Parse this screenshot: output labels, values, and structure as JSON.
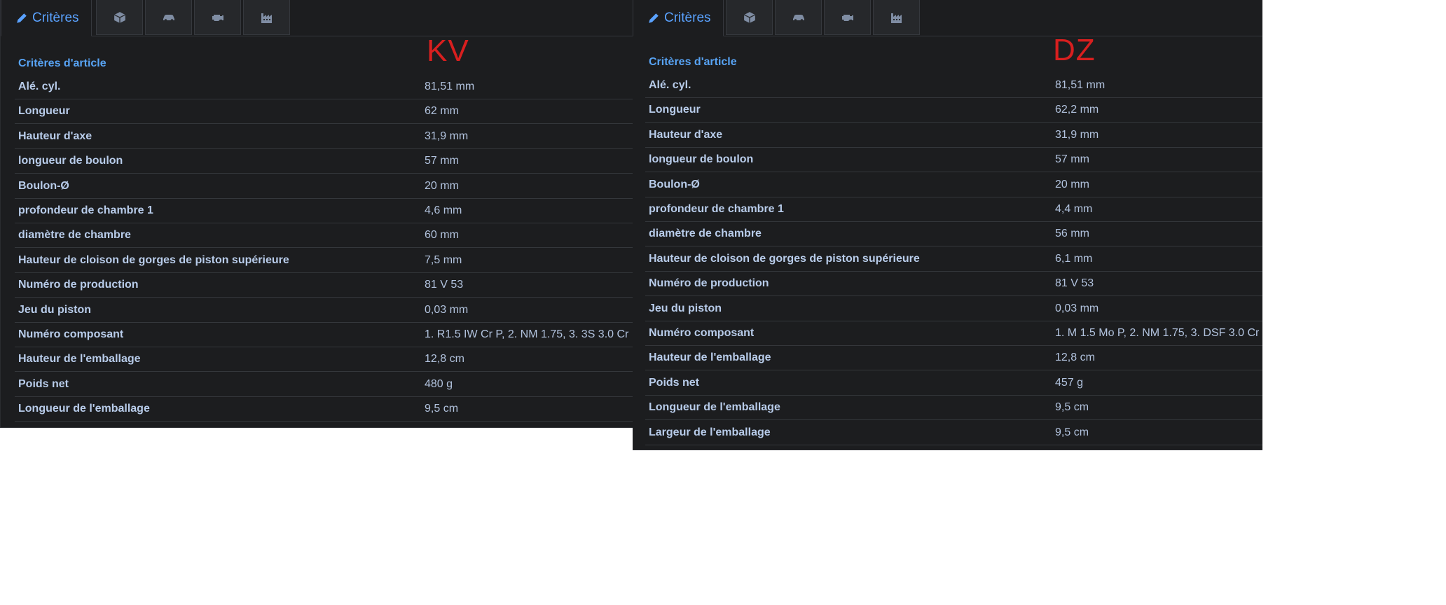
{
  "tabs": {
    "active_label": "Critères",
    "icons": [
      "cube-icon",
      "car-icon",
      "engine-icon",
      "factory-icon"
    ]
  },
  "colors": {
    "background": "#1c1d1f",
    "accent": "#58a4f5",
    "brand": "#d81f1f"
  },
  "panels": [
    {
      "brand": "KV",
      "section_title": "Critères d'article",
      "rows": [
        {
          "label": "Alé. cyl.",
          "value": "81,51 mm"
        },
        {
          "label": "Longueur",
          "value": "62 mm"
        },
        {
          "label": "Hauteur d'axe",
          "value": "31,9 mm"
        },
        {
          "label": "longueur de boulon",
          "value": "57 mm"
        },
        {
          "label": "Boulon-Ø",
          "value": "20 mm"
        },
        {
          "label": "profondeur de chambre 1",
          "value": "4,6 mm"
        },
        {
          "label": "diamètre de chambre",
          "value": "60 mm"
        },
        {
          "label": "Hauteur de cloison de gorges de piston supérieure",
          "value": "7,5 mm"
        },
        {
          "label": "Numéro de production",
          "value": "81 V 53"
        },
        {
          "label": "Jeu du piston",
          "value": "0,03 mm"
        },
        {
          "label": "Numéro composant",
          "value": "1. R1.5 IW Cr P, 2. NM 1.75, 3. 3S 3.0 Cr"
        },
        {
          "label": "Hauteur de l'emballage",
          "value": "12,8 cm"
        },
        {
          "label": "Poids net",
          "value": "480 g"
        },
        {
          "label": "Longueur de l'emballage",
          "value": "9,5 cm"
        }
      ]
    },
    {
      "brand": "DZ",
      "section_title": "Critères d'article",
      "rows": [
        {
          "label": "Alé. cyl.",
          "value": "81,51 mm"
        },
        {
          "label": "Longueur",
          "value": "62,2 mm"
        },
        {
          "label": "Hauteur d'axe",
          "value": "31,9 mm"
        },
        {
          "label": "longueur de boulon",
          "value": "57 mm"
        },
        {
          "label": "Boulon-Ø",
          "value": "20 mm"
        },
        {
          "label": "profondeur de chambre 1",
          "value": "4,4 mm"
        },
        {
          "label": "diamètre de chambre",
          "value": "56 mm"
        },
        {
          "label": "Hauteur de cloison de gorges de piston supérieure",
          "value": "6,1 mm"
        },
        {
          "label": "Numéro de production",
          "value": "81 V 53"
        },
        {
          "label": "Jeu du piston",
          "value": "0,03 mm"
        },
        {
          "label": "Numéro composant",
          "value": "1. M 1.5 Mo P, 2. NM 1.75, 3. DSF 3.0 Cr"
        },
        {
          "label": "Hauteur de l'emballage",
          "value": "12,8 cm"
        },
        {
          "label": "Poids net",
          "value": "457 g"
        },
        {
          "label": "Longueur de l'emballage",
          "value": "9,5 cm"
        },
        {
          "label": "Largeur de l'emballage",
          "value": "9,5 cm"
        }
      ]
    }
  ]
}
